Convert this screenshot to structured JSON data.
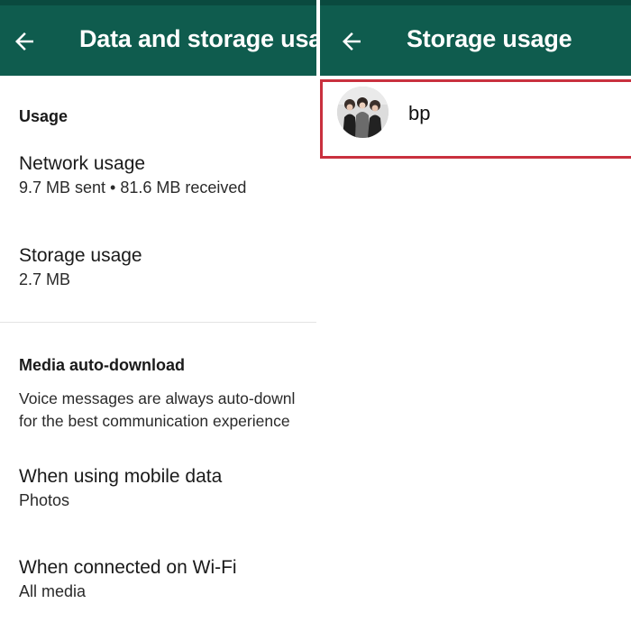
{
  "colors": {
    "toolbar": "#0f5c4e",
    "highlight_border": "#c9303e",
    "icon": "#ffffff"
  },
  "left_screen": {
    "back_icon": "arrow-back-icon",
    "title": "Data and storage usa",
    "usage_section": {
      "header": "Usage",
      "network": {
        "title": "Network usage",
        "subtitle": "9.7 MB sent • 81.6 MB received"
      },
      "storage": {
        "title": "Storage usage",
        "subtitle": "2.7 MB"
      }
    },
    "media_section": {
      "header": "Media auto-download",
      "note_line1": "Voice messages are always auto-downl",
      "note_line2": "for the best communication experience",
      "mobile": {
        "title": "When using mobile data",
        "subtitle": "Photos"
      },
      "wifi": {
        "title": "When connected on Wi-Fi",
        "subtitle": "All media"
      }
    }
  },
  "right_screen": {
    "back_icon": "arrow-back-icon",
    "title": "Storage usage",
    "chats": [
      {
        "name": "bp",
        "avatar_icon": "group-photo-avatar"
      }
    ]
  }
}
